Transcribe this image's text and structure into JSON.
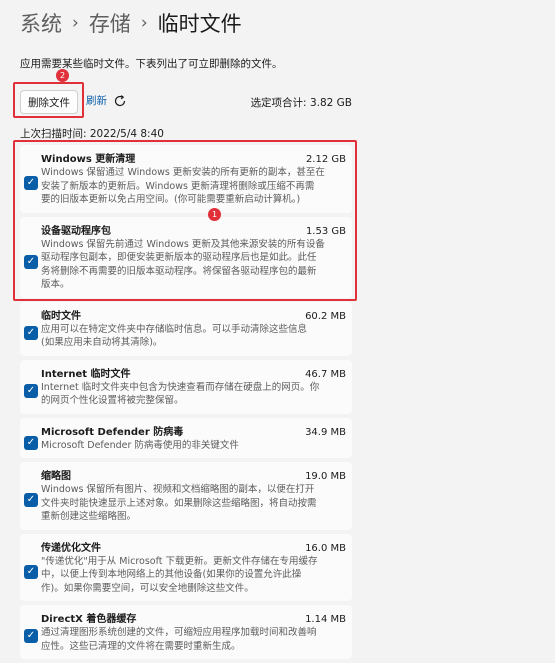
{
  "breadcrumb": {
    "items": [
      "系统",
      "存储",
      "临时文件"
    ]
  },
  "description": "应用需要某些临时文件。下表列出了可立即删除的文件。",
  "toolbar": {
    "delete_label": "删除文件",
    "refresh_label": "刷新",
    "selected_total": "选定项合计: 3.82 GB"
  },
  "last_scan": "上次扫描时间: 2022/5/4 8:40",
  "annotations": {
    "marker_1": "1",
    "marker_2": "2"
  },
  "items": [
    {
      "name": "Windows 更新清理",
      "size": "2.12 GB",
      "checked": true,
      "lines": [
        "Windows 保留通过 Windows 更新安装的所有更新的副本，甚至在",
        "安装了新版本的更新后。Windows 更新清理将删除或压缩不再需",
        "要的旧版本更新以免占用空间。(你可能需要重新启动计算机。)"
      ]
    },
    {
      "name": "设备驱动程序包",
      "size": "1.53 GB",
      "checked": true,
      "lines": [
        "Windows 保留先前通过 Windows 更新及其他来源安装的所有设备",
        "驱动程序包副本，即便安装更新版本的驱动程序后也是如此。此任",
        "务将删除不再需要的旧版本驱动程序。将保留各驱动程序包的最新",
        "版本。"
      ]
    },
    {
      "name": "临时文件",
      "size": "60.2 MB",
      "checked": true,
      "lines": [
        "应用可以在特定文件夹中存储临时信息。可以手动清除这些信息",
        "(如果应用未自动将其清除)。"
      ]
    },
    {
      "name": "Internet 临时文件",
      "size": "46.7 MB",
      "checked": true,
      "lines": [
        "Internet 临时文件夹中包含为快速查看而存储在硬盘上的网页。你",
        "的网页个性化设置将被完整保留。"
      ]
    },
    {
      "name": "Microsoft Defender 防病毒",
      "size": "34.9 MB",
      "checked": true,
      "lines": [
        "Microsoft Defender 防病毒使用的非关键文件"
      ]
    },
    {
      "name": "缩略图",
      "size": "19.0 MB",
      "checked": true,
      "lines": [
        "Windows 保留所有图片、视频和文档缩略图的副本，以便在打开",
        "文件夹时能快速显示上述对象。如果删除这些缩略图，将自动按需",
        "重新创建这些缩略图。"
      ]
    },
    {
      "name": "传递优化文件",
      "size": "16.0 MB",
      "checked": true,
      "lines": [
        "\"传递优化\"用于从 Microsoft 下载更新。更新文件存储在专用缓存",
        "中，以便上传到本地网络上的其他设备(如果你的设置允许此操",
        "作)。如果你需要空间，可以安全地删除这些文件。"
      ]
    },
    {
      "name": "DirectX 着色器缓存",
      "size": "1.14 MB",
      "checked": true,
      "lines": [
        "通过清理图形系统创建的文件，可缩短应用程序加载时间和改善响",
        "应性。这些已清理的文件将在需要时重新生成。"
      ]
    }
  ],
  "colors": {
    "accent": "#0a5ea8",
    "highlight": "#e0303a"
  }
}
